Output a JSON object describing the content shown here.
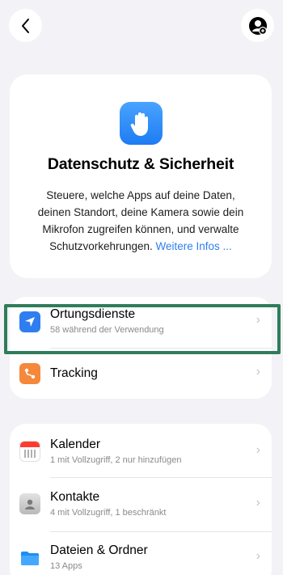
{
  "nav": {
    "back_icon": "chevron-left-icon",
    "share_icon": "person-add-icon"
  },
  "hero": {
    "icon": "raised-hand-icon",
    "title": "Datenschutz & Sicherheit",
    "description_lines": [
      "Steuere, welche Apps auf deine Daten,",
      "deinen Standort, deine Kamera sowie dein",
      "Mikrofon zugreifen können, und verwalte"
    ],
    "description_last": "Schutzvorkehrungen.",
    "link_text": "Weitere Infos ..."
  },
  "group1": [
    {
      "title": "Ortungsdienste",
      "subtitle": "58 während der Verwendung",
      "icon": "location-arrow-icon",
      "color": "#2f7ef0"
    },
    {
      "title": "Tracking",
      "subtitle": "",
      "icon": "tracking-icon",
      "color": "#f5883a"
    }
  ],
  "group2": [
    {
      "title": "Kalender",
      "subtitle": "1 mit Vollzugriff, 2 nur hinzufügen",
      "icon": "calendar-icon"
    },
    {
      "title": "Kontakte",
      "subtitle": "4 mit Vollzugriff, 1 beschränkt",
      "icon": "contacts-icon"
    },
    {
      "title": "Dateien & Ordner",
      "subtitle": "13 Apps",
      "icon": "folder-icon"
    }
  ],
  "chevron": "›",
  "highlight_color": "#2e7d5a"
}
